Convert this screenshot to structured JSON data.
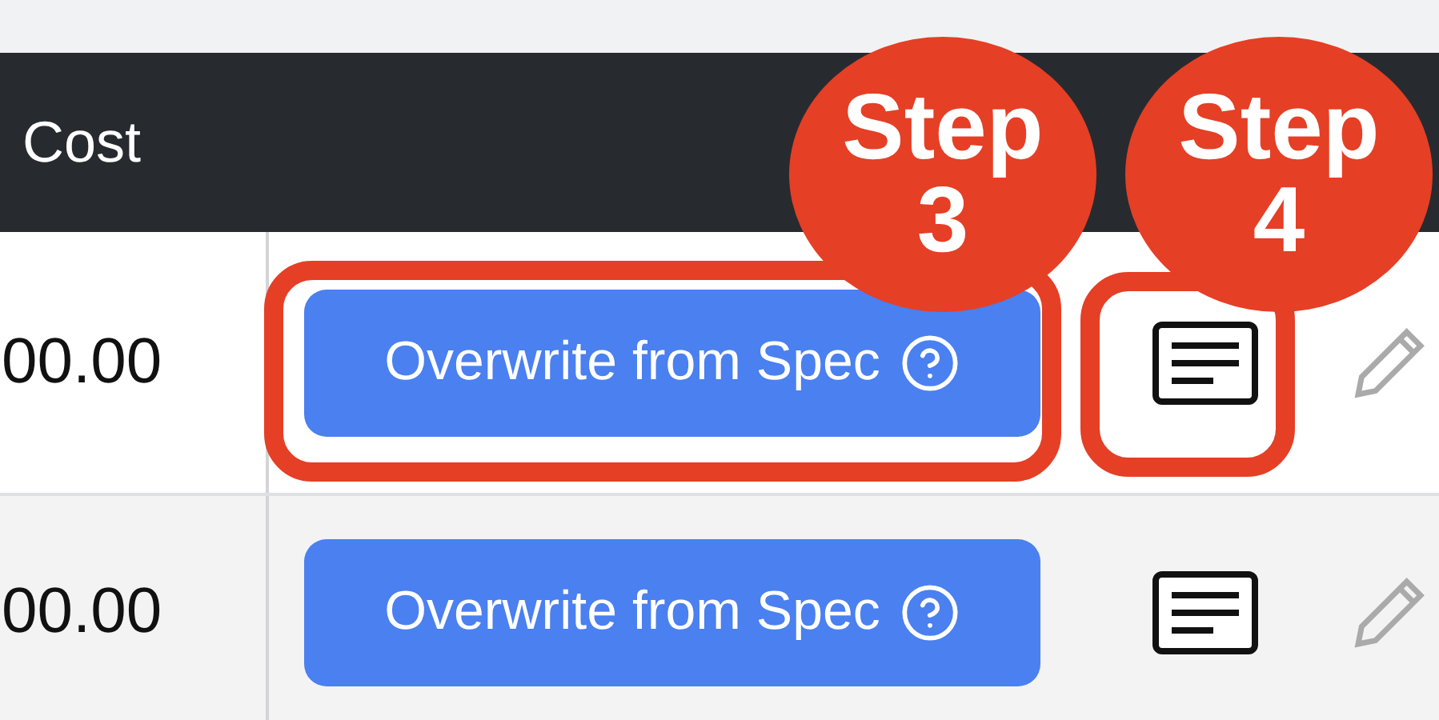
{
  "header": {
    "columns": [
      "Cost"
    ]
  },
  "rows": [
    {
      "cost": "00.00",
      "action": "Overwrite from Spec"
    },
    {
      "cost": "00.00",
      "action": "Overwrite from Spec"
    }
  ],
  "annotations": [
    {
      "kind": "button",
      "label": "Step",
      "number": "3"
    },
    {
      "kind": "note",
      "label": "Step",
      "number": "4"
    }
  ]
}
